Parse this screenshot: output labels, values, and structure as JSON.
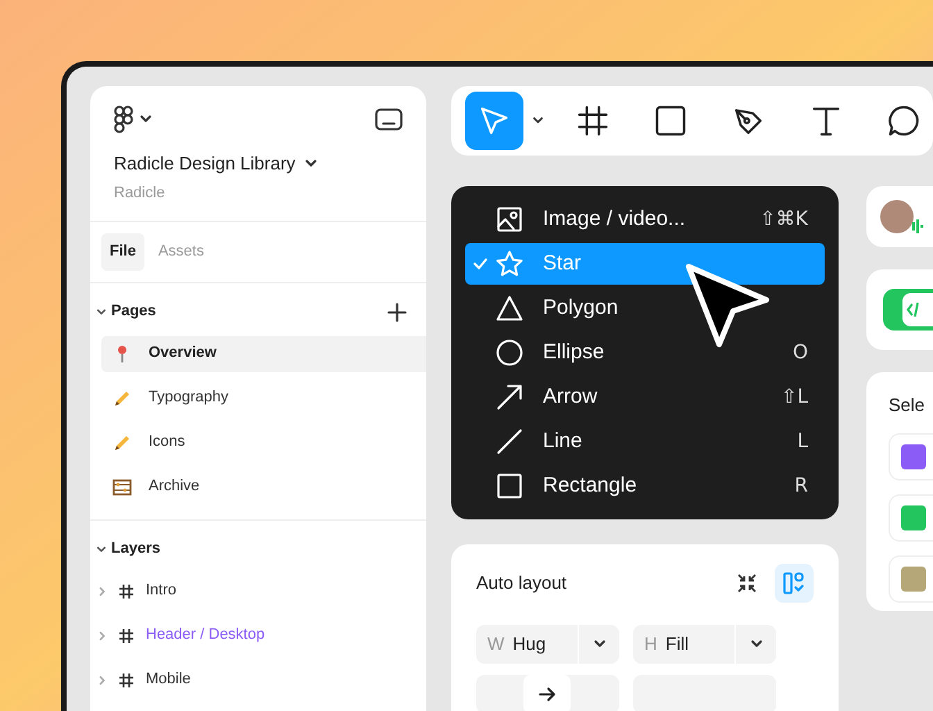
{
  "sidebar": {
    "file_title": "Radicle Design Library",
    "team": "Radicle",
    "tabs": [
      {
        "label": "File",
        "selected": true
      },
      {
        "label": "Assets",
        "selected": false
      }
    ],
    "pages_title": "Pages",
    "pages": [
      {
        "label": "Overview",
        "kind": "pin",
        "selected": true
      },
      {
        "label": "Typography",
        "kind": "pencil",
        "selected": false
      },
      {
        "label": "Icons",
        "kind": "pencil",
        "selected": false
      },
      {
        "label": "Archive",
        "kind": "abacus",
        "selected": false
      }
    ],
    "layers_title": "Layers",
    "layers": [
      {
        "label": "Intro",
        "highlighted": false
      },
      {
        "label": "Header / Desktop",
        "highlighted": true
      },
      {
        "label": "Mobile",
        "highlighted": false
      }
    ]
  },
  "toolbar": {
    "tools": [
      {
        "kind": "move",
        "selected": true
      },
      {
        "kind": "frame",
        "selected": false
      },
      {
        "kind": "rectangle",
        "selected": false
      },
      {
        "kind": "pen",
        "selected": false
      },
      {
        "kind": "text",
        "selected": false
      },
      {
        "kind": "comment",
        "selected": false
      }
    ]
  },
  "shape_menu": [
    {
      "kind": "image",
      "label": "Image / video...",
      "shortcut": "⇧⌘K",
      "selected": false
    },
    {
      "kind": "star",
      "label": "Star",
      "selected": true
    },
    {
      "kind": "polygon",
      "label": "Polygon",
      "selected": false
    },
    {
      "kind": "ellipse",
      "label": "Ellipse",
      "shortcut": "O",
      "selected": false
    },
    {
      "kind": "arrow",
      "label": "Arrow",
      "shortcut": "⇧L",
      "selected": false
    },
    {
      "kind": "line",
      "label": "Line",
      "shortcut": "L",
      "selected": false
    },
    {
      "kind": "rectangle",
      "label": "Rectangle",
      "shortcut": "R",
      "selected": false
    }
  ],
  "auto_layout": {
    "title": "Auto layout",
    "width": {
      "prefix": "W",
      "value": "Hug"
    },
    "height": {
      "prefix": "H",
      "value": "Fill"
    }
  },
  "right": {
    "code_toggle_on": true,
    "selection_title": "Sele",
    "swatches": [
      {
        "color": "#8b5cf6"
      },
      {
        "color": "#22c55e"
      },
      {
        "color": "#b5a777"
      }
    ]
  }
}
